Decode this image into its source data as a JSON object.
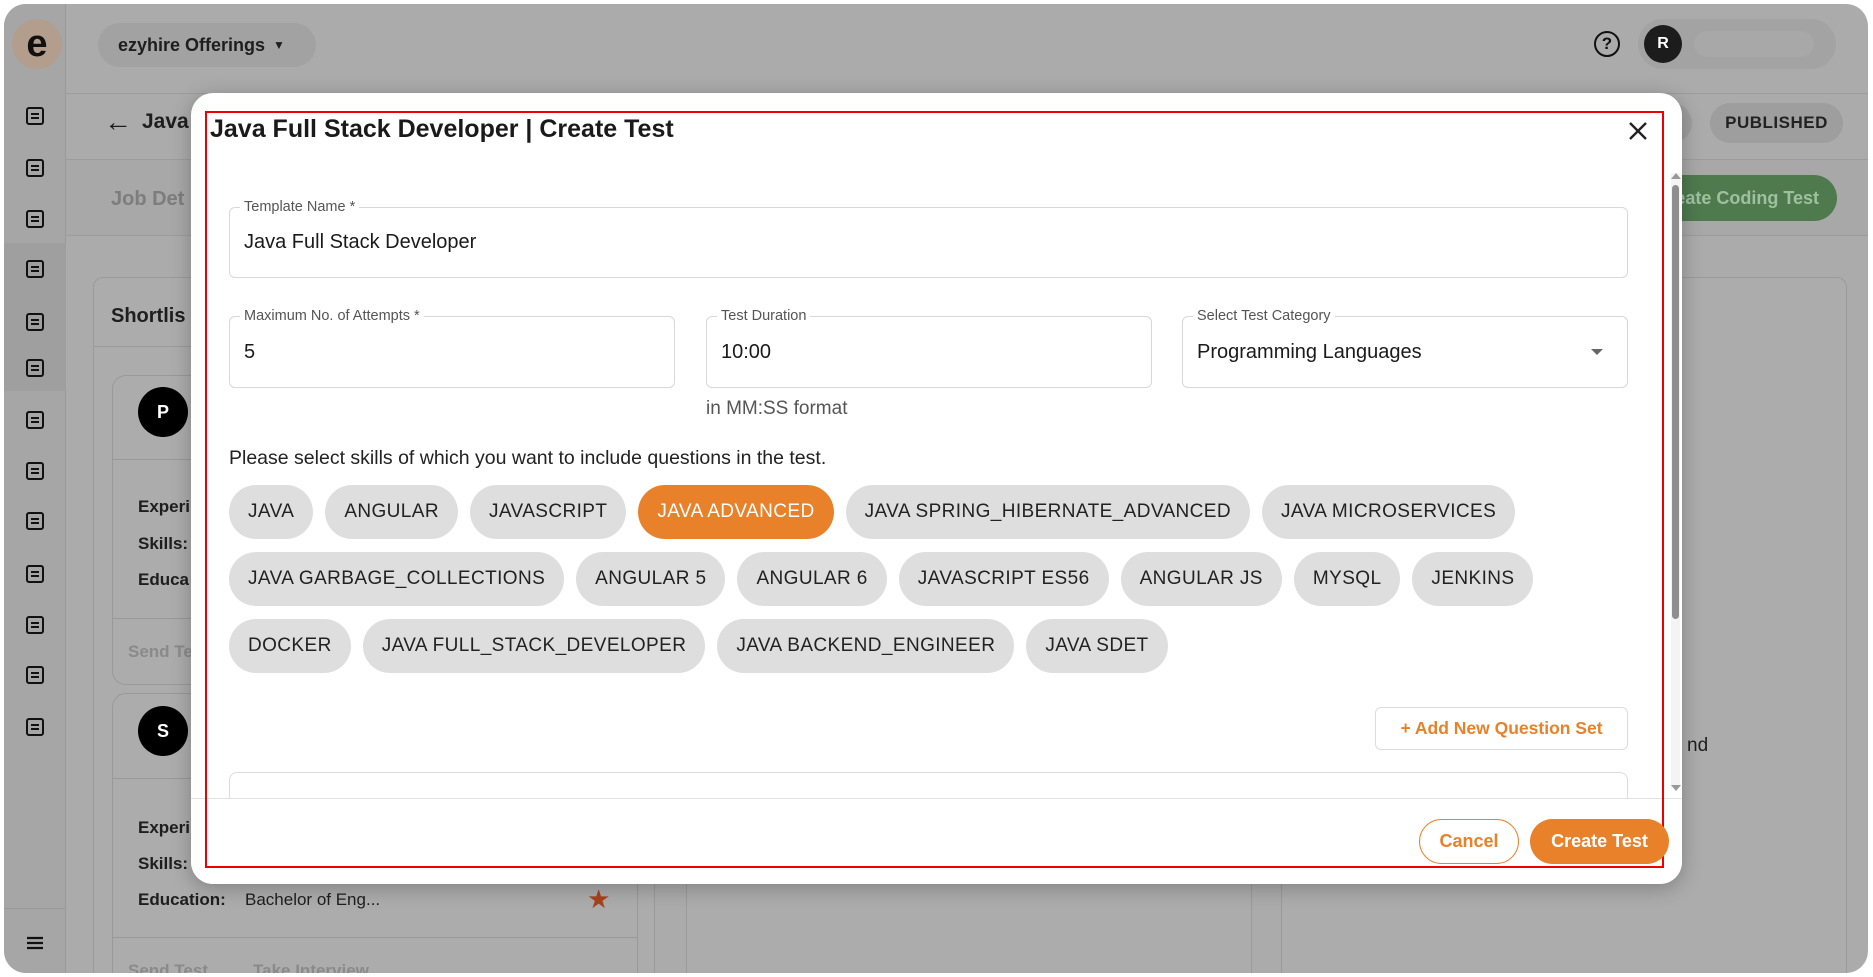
{
  "app": {
    "logo_letter": "e",
    "offerings_label": "ezyhire Offerings",
    "user_initial": "R",
    "sidebar_icons": [
      "users-icon",
      "building-icon",
      "briefcase-icon",
      "briefcase-active-icon",
      "add-document-icon",
      "clipboard-icon",
      "chat-icon",
      "add-user-icon",
      "book-icon",
      "ticket-icon",
      "store-icon",
      "account-circle-icon",
      "dashboard-icon"
    ],
    "menu_icon": "menu-icon"
  },
  "page": {
    "breadcrumb_title": "Java",
    "status_badge": "PUBLISHED",
    "tab_label": "Job Det",
    "coding_test_button": "Create Coding Test",
    "column_title": "Shortlis",
    "right_text": "nd",
    "candidates": [
      {
        "initial": "P",
        "experience_label": "Experi",
        "skills_label": "Skills:",
        "education_label": "Educa",
        "actions": [
          "Send Te"
        ]
      },
      {
        "initial": "S",
        "experience_label": "Experi",
        "skills_label": "Skills:",
        "education_label": "Education:",
        "education_value": "Bachelor of Eng...",
        "actions": [
          "Send Test",
          "Take Interview"
        ]
      }
    ]
  },
  "modal": {
    "title": "Java Full Stack Developer | Create Test",
    "template_name": {
      "label": "Template Name *",
      "value": "Java Full Stack Developer"
    },
    "max_attempts": {
      "label": "Maximum No. of Attempts *",
      "value": "5"
    },
    "test_duration": {
      "label": "Test Duration",
      "value": "10:00",
      "helper": "in MM:SS format"
    },
    "test_category": {
      "label": "Select Test Category",
      "value": "Programming Languages"
    },
    "skills_prompt": "Please select skills of which you want to include questions in the test.",
    "skills": [
      {
        "label": "JAVA",
        "selected": false
      },
      {
        "label": "ANGULAR",
        "selected": false
      },
      {
        "label": "JAVASCRIPT",
        "selected": false
      },
      {
        "label": "JAVA ADVANCED",
        "selected": true
      },
      {
        "label": "JAVA SPRING_HIBERNATE_ADVANCED",
        "selected": false
      },
      {
        "label": "JAVA MICROSERVICES",
        "selected": false
      },
      {
        "label": "JAVA GARBAGE_COLLECTIONS",
        "selected": false
      },
      {
        "label": "ANGULAR 5",
        "selected": false
      },
      {
        "label": "ANGULAR 6",
        "selected": false
      },
      {
        "label": "JAVASCRIPT ES56",
        "selected": false
      },
      {
        "label": "ANGULAR JS",
        "selected": false
      },
      {
        "label": "MYSQL",
        "selected": false
      },
      {
        "label": "JENKINS",
        "selected": false
      },
      {
        "label": "DOCKER",
        "selected": false
      },
      {
        "label": "JAVA FULL_STACK_DEVELOPER",
        "selected": false
      },
      {
        "label": "JAVA BACKEND_ENGINEER",
        "selected": false
      },
      {
        "label": "JAVA SDET",
        "selected": false
      }
    ],
    "add_question_set": "+ Add New Question Set",
    "cancel": "Cancel",
    "create": "Create Test"
  },
  "colors": {
    "accent": "#e8812a",
    "selected_chip": "#e8812a",
    "chip": "#dedede",
    "published_green": "#4e7a4e",
    "overlay": "#ababab"
  }
}
